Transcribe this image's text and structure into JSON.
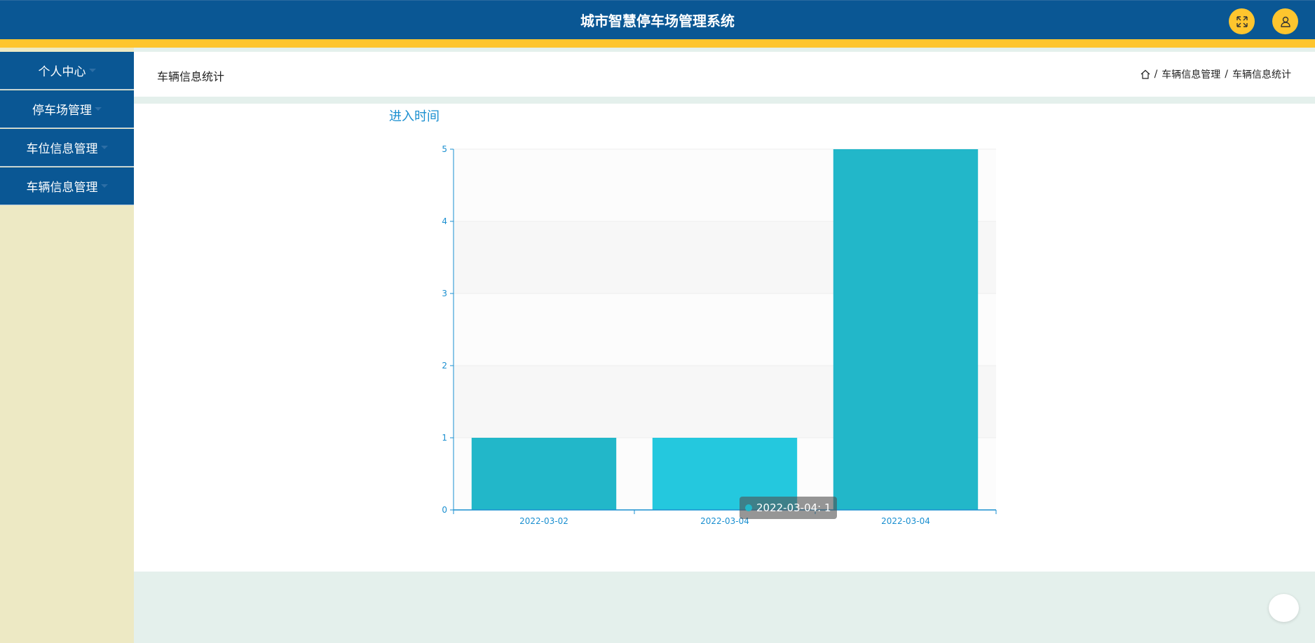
{
  "header": {
    "title": "城市智慧停车场管理系统",
    "fullscreen_icon": "expand-icon",
    "user_icon": "user-icon"
  },
  "sidebar": {
    "items": [
      {
        "label": "个人中心"
      },
      {
        "label": "停车场管理"
      },
      {
        "label": "车位信息管理"
      },
      {
        "label": "车辆信息管理"
      }
    ]
  },
  "page": {
    "title": "车辆信息统计",
    "breadcrumb": [
      "车辆信息管理",
      "车辆信息统计"
    ],
    "breadcrumb_sep": "/"
  },
  "chart_data": {
    "type": "bar",
    "title": "进入时间",
    "categories": [
      "2022-03-02",
      "2022-03-04",
      "2022-03-04"
    ],
    "values": [
      1,
      1,
      5
    ],
    "ylim": [
      0,
      5
    ],
    "yticks": [
      0,
      1,
      2,
      3,
      4,
      5
    ],
    "grid": true,
    "bar_color": "#22b7c9",
    "highlight_color": "#24c8de",
    "highlight_index": 1,
    "tooltip": "2022-03-04: 1"
  }
}
